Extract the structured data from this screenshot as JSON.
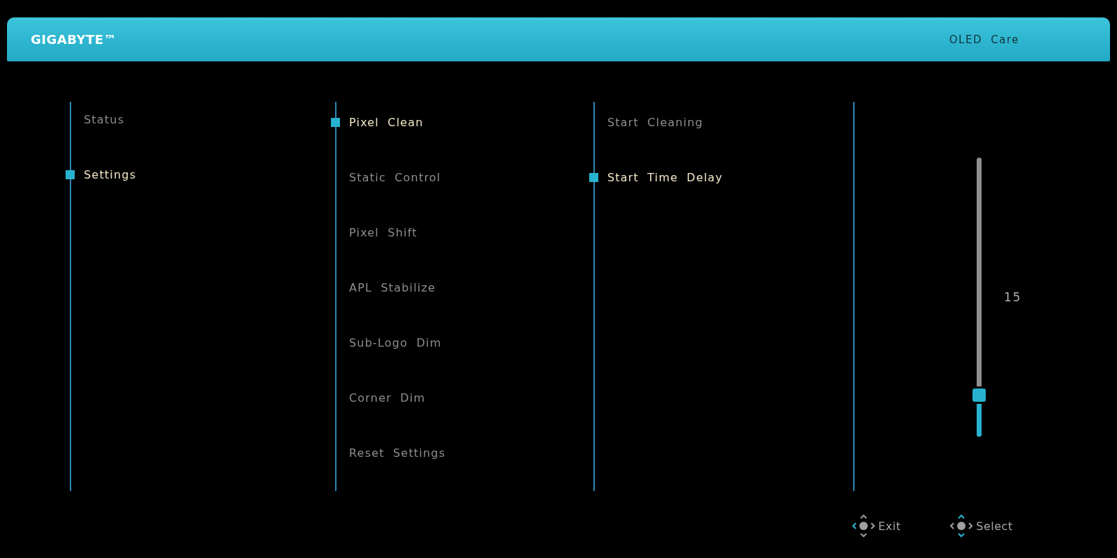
{
  "header": {
    "brand": "GIGABYTE™",
    "title": "OLED Care"
  },
  "menu": [
    {
      "label": "Status",
      "selected": false
    },
    {
      "label": "Settings",
      "selected": true
    }
  ],
  "submenu": [
    {
      "label": "Pixel Clean",
      "selected": true
    },
    {
      "label": "Static Control",
      "selected": false
    },
    {
      "label": "Pixel Shift",
      "selected": false
    },
    {
      "label": "APL Stabilize",
      "selected": false
    },
    {
      "label": "Sub-Logo Dim",
      "selected": false
    },
    {
      "label": "Corner Dim",
      "selected": false
    },
    {
      "label": "Reset Settings",
      "selected": false
    }
  ],
  "options": [
    {
      "label": "Start Cleaning",
      "selected": false
    },
    {
      "label": "Start Time Delay",
      "selected": true
    }
  ],
  "slider": {
    "value": "15",
    "level": 0.15
  },
  "footer": [
    {
      "kind": "exit",
      "label": "Exit"
    },
    {
      "kind": "select",
      "label": "Select"
    }
  ]
}
